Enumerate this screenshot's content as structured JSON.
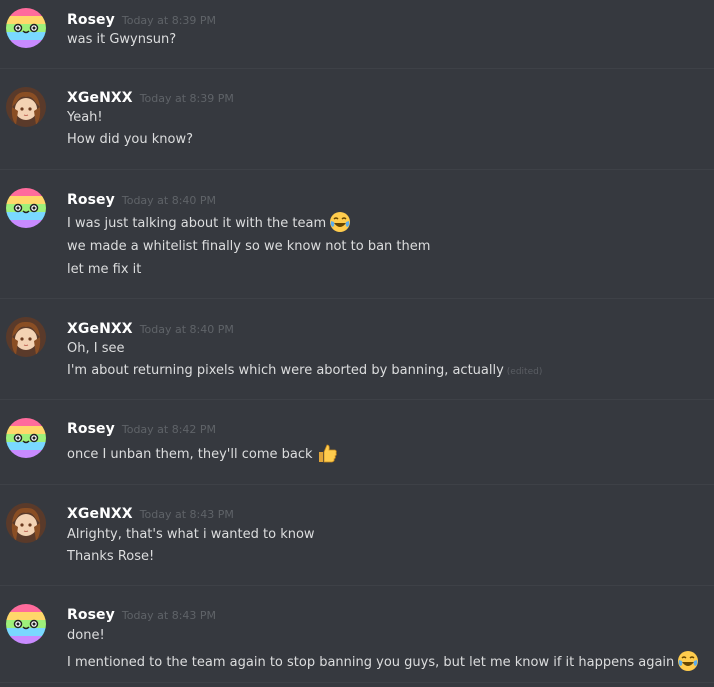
{
  "colors": {
    "background": "#36393f",
    "author": "#ffffff",
    "text": "#dcddde",
    "timestamp": "#5f6368",
    "divider": "#3e4147"
  },
  "messages": [
    {
      "author": "Rosey",
      "avatar": "rainbow-slime-avatar",
      "timestamp": "Today at 8:39 PM",
      "lines": [
        {
          "text": "was it Gwynsun?"
        }
      ]
    },
    {
      "author": "XGeNXX",
      "avatar": "anime-girl-avatar",
      "timestamp": "Today at 8:39 PM",
      "lines": [
        {
          "text": "Yeah!"
        },
        {
          "text": "How did you know?"
        }
      ]
    },
    {
      "author": "Rosey",
      "avatar": "rainbow-slime-avatar",
      "timestamp": "Today at 8:40 PM",
      "lines": [
        {
          "text": "I was just talking about it with the team",
          "emoji": "joy-emoji"
        },
        {
          "text": "we made a whitelist finally so we know not to ban them"
        },
        {
          "text": "let me fix it"
        }
      ]
    },
    {
      "author": "XGeNXX",
      "avatar": "anime-girl-avatar",
      "timestamp": "Today at 8:40 PM",
      "lines": [
        {
          "text": "Oh, I see"
        },
        {
          "text": "I'm about returning pixels which were aborted by banning, actually",
          "edited": "(edited)"
        }
      ]
    },
    {
      "author": "Rosey",
      "avatar": "rainbow-slime-avatar",
      "timestamp": "Today at 8:42 PM",
      "lines": [
        {
          "text": "once I unban them, they'll come back",
          "emoji": "thumbs-up-emoji"
        }
      ]
    },
    {
      "author": "XGeNXX",
      "avatar": "anime-girl-avatar",
      "timestamp": "Today at 8:43 PM",
      "lines": [
        {
          "text": "Alrighty, that's what i wanted to know"
        },
        {
          "text": "Thanks Rose!"
        }
      ]
    },
    {
      "author": "Rosey",
      "avatar": "rainbow-slime-avatar",
      "timestamp": "Today at 8:43 PM",
      "lines": [
        {
          "text": "done!"
        },
        {
          "text": "I mentioned to the team again to stop banning you guys, but let me know if it happens again",
          "emoji": "joy-emoji"
        }
      ]
    }
  ]
}
